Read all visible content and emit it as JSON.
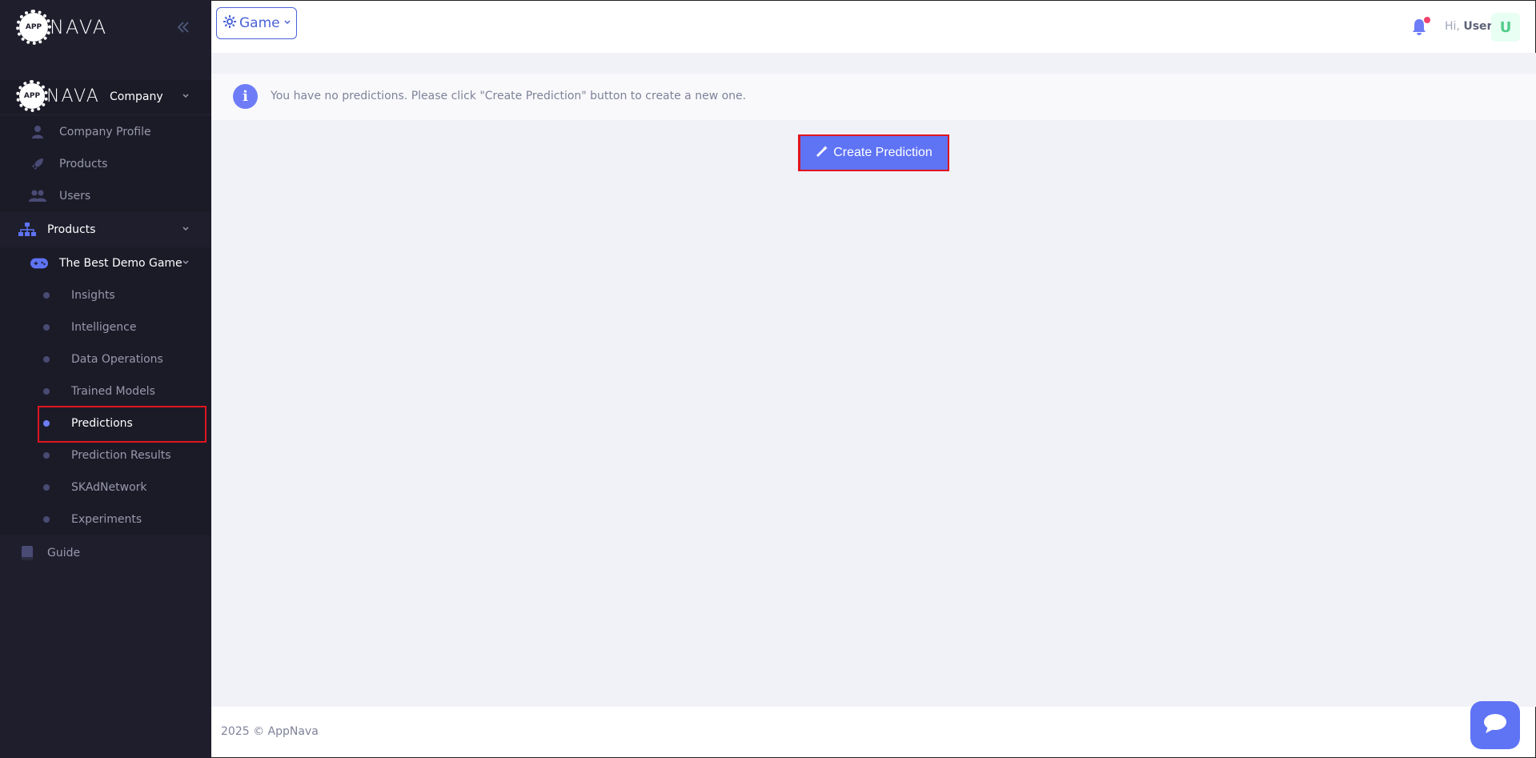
{
  "brand": {
    "logo_badge": "APP",
    "logo_word": "NAVA"
  },
  "topbar": {
    "game_label": "Game",
    "greeting_prefix": "Hi,",
    "user_name": "User",
    "avatar_letter": "U"
  },
  "sidebar": {
    "company_label": "Company",
    "company_items": [
      {
        "label": "Company Profile",
        "icon": "user-icon"
      },
      {
        "label": "Products",
        "icon": "rocket-icon"
      },
      {
        "label": "Users",
        "icon": "users-icon"
      }
    ],
    "products_label": "Products",
    "game_label": "The Best Demo Game",
    "game_items": [
      {
        "label": "Insights"
      },
      {
        "label": "Intelligence"
      },
      {
        "label": "Data Operations"
      },
      {
        "label": "Trained Models"
      },
      {
        "label": "Predictions",
        "active": true
      },
      {
        "label": "Prediction Results"
      },
      {
        "label": "SKAdNetwork"
      },
      {
        "label": "Experiments"
      }
    ],
    "guide_label": "Guide"
  },
  "alert": {
    "message": "You have no predictions. Please click \"Create Prediction\" button to create a new one."
  },
  "main": {
    "create_button_label": "Create Prediction"
  },
  "footer": {
    "copyright": "2025 © AppNava"
  },
  "colors": {
    "sidebar_bg": "#1e1e2d",
    "accent": "#5f73f5",
    "highlight": "#e0151e",
    "page_bg": "#f0f2f7"
  }
}
